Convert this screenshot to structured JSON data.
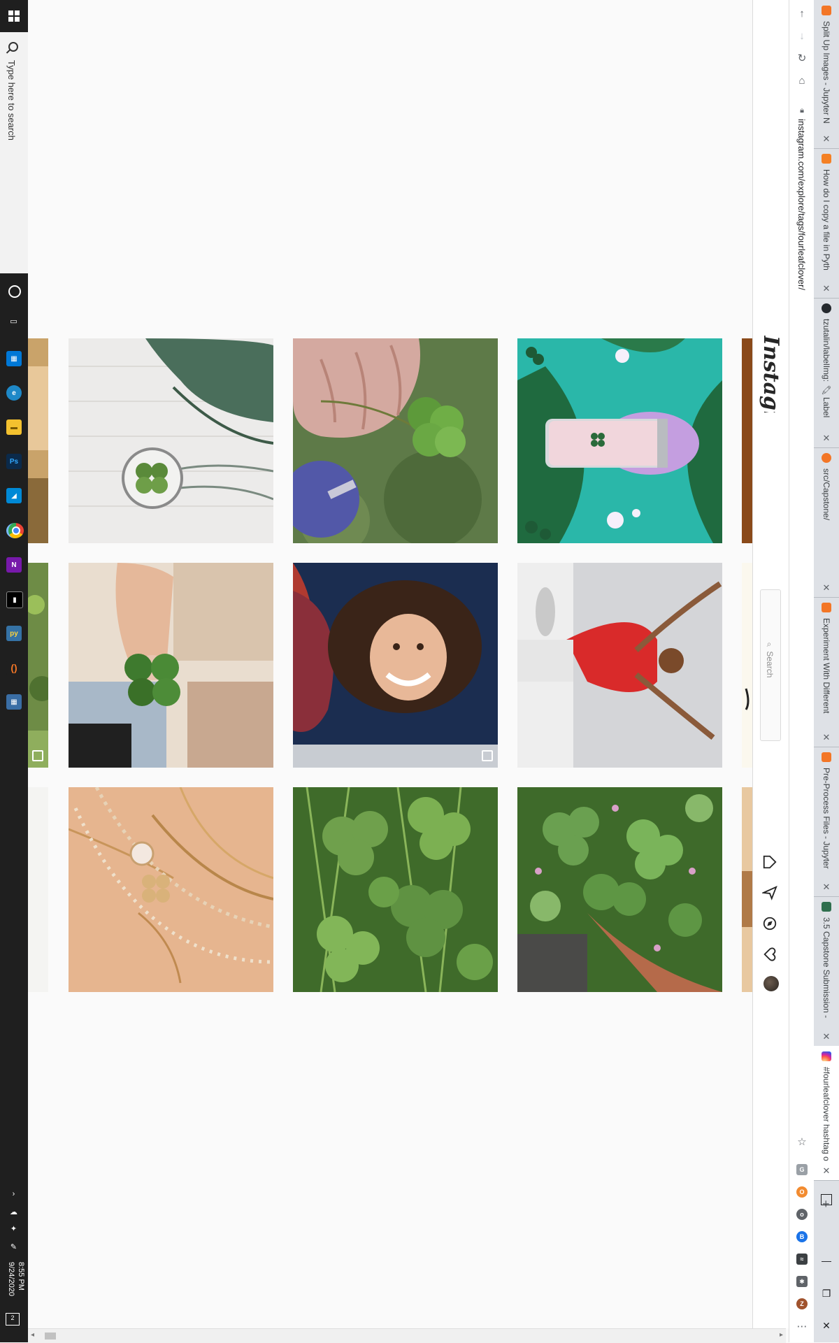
{
  "taskbar": {
    "search_placeholder": "Type here to search",
    "apps": [
      "windows-store",
      "edge",
      "file-explorer",
      "photoshop",
      "azure",
      "chrome",
      "onenote",
      "terminal",
      "python",
      "jupyter",
      "calculator"
    ],
    "clock_time": "8:55 PM",
    "clock_date": "9/24/2020",
    "notification_count": "2"
  },
  "browser": {
    "url": "instagram.com/explore/tags/fourleafclover/",
    "tabs": [
      {
        "title": "Split Up Images - Jupyter N",
        "favicon_color": "#f37626"
      },
      {
        "title": "How do I copy a file in Pyth",
        "favicon_color": "#f48024"
      },
      {
        "title": "tzutalin/labelImg: 🖍 Label",
        "favicon_color": "#24292e"
      },
      {
        "title": "src/Capstone/",
        "favicon_color": "#f37626"
      },
      {
        "title": "Experiment With Different",
        "favicon_color": "#f37626"
      },
      {
        "title": "Pre-Process Files - Jupyter",
        "favicon_color": "#f37626"
      },
      {
        "title": "3.5 Capstone Submission -",
        "favicon_color": "#2f6f4e"
      },
      {
        "title": "#fourleafclover hashtag o",
        "favicon_color": "#d6249f"
      }
    ],
    "new_tab_label": "+",
    "extensions": [
      "G",
      "O",
      "o",
      "B",
      "≈",
      "✱",
      "Z"
    ]
  },
  "instagram": {
    "logo": "Instagram",
    "search_placeholder": "Search"
  }
}
